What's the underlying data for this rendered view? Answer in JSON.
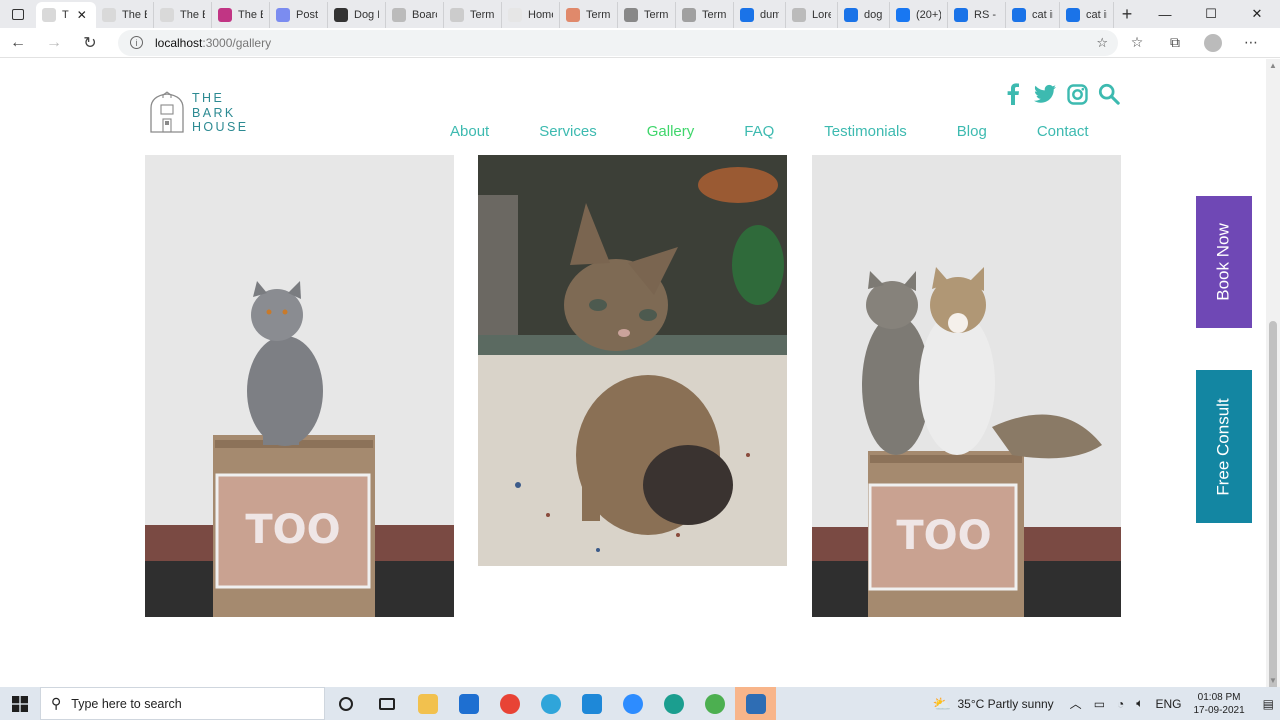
{
  "browser": {
    "tabs": [
      {
        "title": "T",
        "active": true,
        "color": "#d9d9d9"
      },
      {
        "title": "The B",
        "color": "#d9d9d9"
      },
      {
        "title": "The B",
        "color": "#d9d9d9"
      },
      {
        "title": "The B",
        "color": "#c13584"
      },
      {
        "title": "Post",
        "color": "#7b8cf0"
      },
      {
        "title": "Dog E",
        "color": "#333333"
      },
      {
        "title": "Boarc",
        "color": "#bbbbbb"
      },
      {
        "title": "Term",
        "color": "#cccccc"
      },
      {
        "title": "Home",
        "color": "#e6e6e6"
      },
      {
        "title": "Term",
        "color": "#e0896b"
      },
      {
        "title": "Term",
        "color": "#888888"
      },
      {
        "title": "Term",
        "color": "#a0a0a0"
      },
      {
        "title": "dumn",
        "color": "#1a73e8"
      },
      {
        "title": "Loren",
        "color": "#bbbbbb"
      },
      {
        "title": "dog j",
        "color": "#1a73e8"
      },
      {
        "title": "(20+)",
        "color": "#1877f2"
      },
      {
        "title": "RS - E",
        "color": "#1a73e8"
      },
      {
        "title": "cat in",
        "color": "#1a73e8"
      },
      {
        "title": "cat in",
        "color": "#1a73e8"
      }
    ],
    "url_host": "localhost",
    "url_path": ":3000/gallery"
  },
  "site": {
    "logo_line1": "THE",
    "logo_line2": "BARK",
    "logo_line3": "HOUSE",
    "social_icons": [
      "facebook-icon",
      "twitter-icon",
      "instagram-icon",
      "search-icon"
    ],
    "nav": [
      "About",
      "Services",
      "Gallery",
      "FAQ",
      "Testimonials",
      "Blog",
      "Contact"
    ],
    "active_nav": "Gallery",
    "book_now": "Book Now",
    "free_consult": "Free Consult",
    "colors": {
      "teal": "#3dbab0",
      "active": "#3fd66b",
      "book": "#6f48b5",
      "consult": "#1386a2",
      "logo": "#2c8a92"
    }
  },
  "taskbar": {
    "search_placeholder": "Type here to search",
    "weather": "35°C  Partly sunny",
    "lang": "ENG",
    "time": "01:08 PM",
    "date": "17-09-2021"
  }
}
